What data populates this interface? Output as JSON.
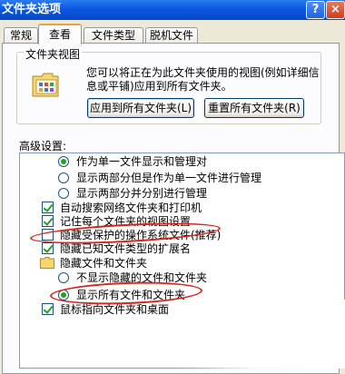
{
  "window": {
    "title": "文件夹选项",
    "help_btn": "?",
    "close_btn": "×"
  },
  "tabs": [
    "常规",
    "查看",
    "文件类型",
    "脱机文件"
  ],
  "active_tab": "查看",
  "folder_view": {
    "group_label": "文件夹视图",
    "description": "您可以将正在为此文件夹使用的视图(例如详细信息或平铺)应用到所有文件夹。",
    "apply_button": "应用到所有文件夹(L)",
    "reset_button": "重置所有文件夹(R)"
  },
  "advanced": {
    "label": "高级设置:",
    "items": [
      {
        "type": "radio",
        "checked": true,
        "label": "作为单一文件显示和管理对"
      },
      {
        "type": "radio",
        "checked": false,
        "label": "显示两部分但是作为单一文件进行管理"
      },
      {
        "type": "radio",
        "checked": false,
        "label": "显示两部分并分别进行管理"
      },
      {
        "type": "checkbox",
        "checked": true,
        "label": "自动搜索网络文件夹和打印机"
      },
      {
        "type": "checkbox",
        "checked": true,
        "label": "记住每个文件夹的视图设置"
      },
      {
        "type": "checkbox",
        "checked": false,
        "label": "隐藏受保护的操作系统文件(推荐)"
      },
      {
        "type": "checkbox",
        "checked": true,
        "label": "隐藏已知文件类型的扩展名"
      },
      {
        "type": "folder",
        "label": "隐藏文件和文件夹"
      },
      {
        "type": "radio",
        "checked": false,
        "label": "不显示隐藏的文件和文件夹"
      },
      {
        "type": "radio",
        "checked": true,
        "label": "显示所有文件和文件夹"
      },
      {
        "type": "checkbox",
        "checked": true,
        "label": "鼠标指向文件夹和桌面"
      }
    ]
  },
  "colors": {
    "titlebar": "#0a58e0",
    "annotation": "#d9261c",
    "dialog_bg": "#ece9d8"
  }
}
